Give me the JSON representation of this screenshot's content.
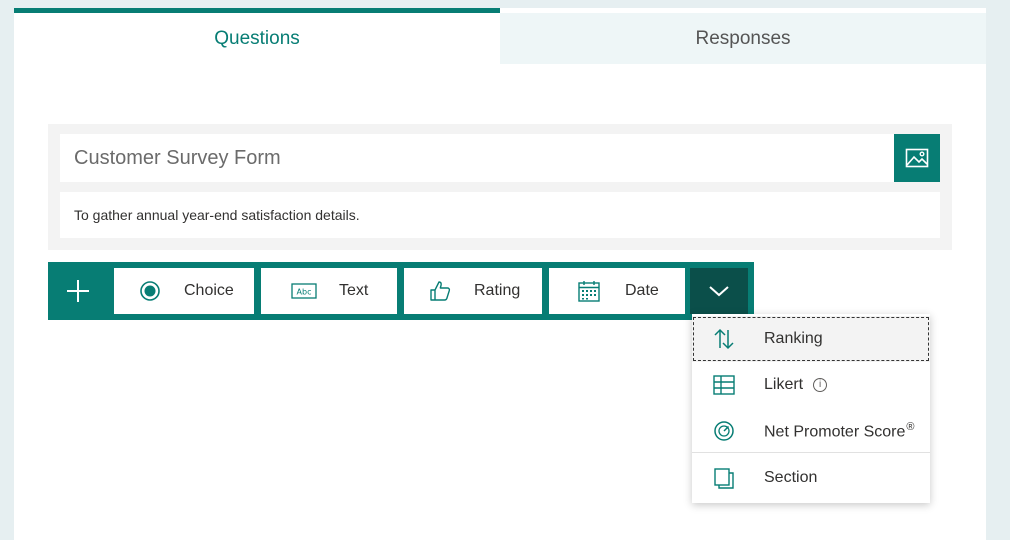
{
  "tabs": {
    "questions": "Questions",
    "responses": "Responses"
  },
  "form": {
    "title": "Customer Survey Form",
    "description": "To gather annual year-end satisfaction details."
  },
  "toolbar": {
    "choice": "Choice",
    "text": "Text",
    "rating": "Rating",
    "date": "Date"
  },
  "more_menu": {
    "ranking": "Ranking",
    "likert": "Likert",
    "nps": "Net Promoter Score",
    "nps_mark": "®",
    "section": "Section"
  },
  "icons": {
    "add": "plus-icon",
    "choice": "radio-icon",
    "text": "text-abc-icon",
    "rating": "thumbs-up-icon",
    "date": "calendar-icon",
    "more": "chevron-down-icon",
    "ranking": "up-down-arrows-icon",
    "likert": "grid-icon",
    "nps": "gauge-icon",
    "section": "section-icon",
    "image": "image-icon",
    "info": "info-icon"
  },
  "colors": {
    "accent": "#077d74",
    "accent_dark": "#0b4f4a",
    "page_bg": "#e6eff1"
  }
}
